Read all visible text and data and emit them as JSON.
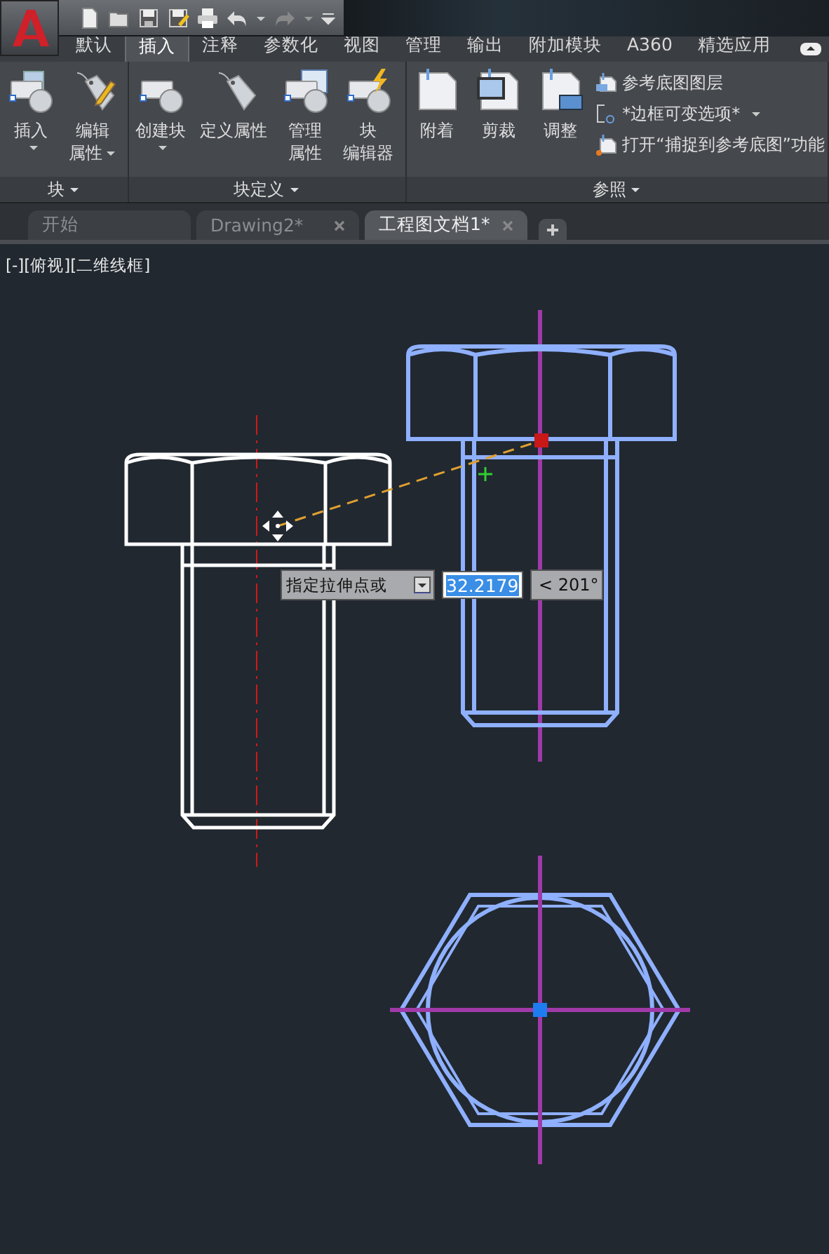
{
  "ribbon_tabs": [
    {
      "label": "默认",
      "selected": false
    },
    {
      "label": "插入",
      "selected": true
    },
    {
      "label": "注释",
      "selected": false
    },
    {
      "label": "参数化",
      "selected": false
    },
    {
      "label": "视图",
      "selected": false
    },
    {
      "label": "管理",
      "selected": false
    },
    {
      "label": "输出",
      "selected": false
    },
    {
      "label": "附加模块",
      "selected": false
    },
    {
      "label": "A360",
      "selected": false
    },
    {
      "label": "精选应用",
      "selected": false
    }
  ],
  "ribbon_panels": [
    {
      "title": "块",
      "items": [
        {
          "kind": "large",
          "lines": [
            "插入"
          ],
          "dropdown": true
        },
        {
          "kind": "large",
          "lines": [
            "编辑",
            "属性"
          ],
          "dropdown": true
        }
      ]
    },
    {
      "title": "块定义",
      "items": [
        {
          "kind": "large",
          "lines": [
            "创建块"
          ],
          "dropdown": true
        },
        {
          "kind": "large",
          "lines": [
            "定义属性"
          ],
          "dropdown": false
        },
        {
          "kind": "large",
          "lines": [
            "管理",
            "属性"
          ],
          "dropdown": false
        },
        {
          "kind": "large",
          "lines": [
            "块",
            "编辑器"
          ],
          "dropdown": false
        }
      ]
    },
    {
      "title": "参照",
      "items": [
        {
          "kind": "large",
          "lines": [
            "附着"
          ],
          "dropdown": false
        },
        {
          "kind": "large",
          "lines": [
            "剪裁"
          ],
          "dropdown": false
        },
        {
          "kind": "large",
          "lines": [
            "调整"
          ],
          "dropdown": false
        },
        {
          "kind": "small",
          "lines": [
            "参考底图图层"
          ],
          "dropdown": false
        },
        {
          "kind": "small",
          "lines": [
            "*边框可变选项*"
          ],
          "dropdown": true
        },
        {
          "kind": "small",
          "lines": [
            "打开“捕捉到参考底图”功能"
          ],
          "dropdown": false
        }
      ]
    }
  ],
  "doc_tabs": [
    {
      "label": "开始",
      "selected": false,
      "closable": false
    },
    {
      "label": "Drawing2*",
      "selected": false,
      "closable": true
    },
    {
      "label": "工程图文档1*",
      "selected": true,
      "closable": true
    }
  ],
  "viewport_label": "[-][俯视][二维线框]",
  "dynamic_input": {
    "prompt": "指定拉伸点或",
    "value": "32.2179",
    "value_selected": true,
    "angle": "< 201°"
  }
}
